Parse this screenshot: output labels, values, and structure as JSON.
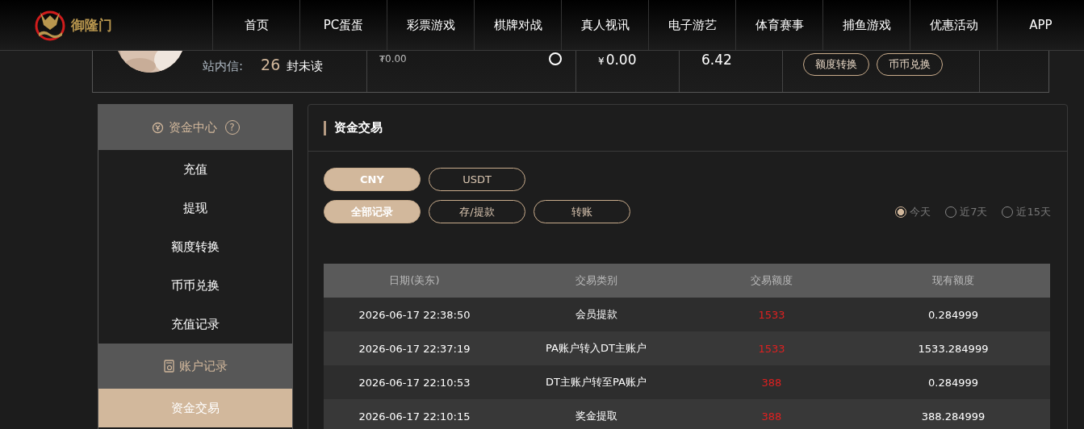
{
  "header": {
    "logo_text": "御隆门",
    "nav": [
      "首页",
      "PC蛋蛋",
      "彩票游戏",
      "棋牌对战",
      "真人视讯",
      "电子游艺",
      "体育赛事",
      "捕鱼游戏",
      "优惠活动",
      "APP"
    ]
  },
  "user_panel": {
    "messages_label": "站内信:",
    "unread_count": "26",
    "unread_suffix": "封未读",
    "balances": [
      {
        "kind": "small",
        "currency": "₮",
        "amount": "0.00"
      },
      {
        "kind": "large",
        "currency": "¥",
        "amount": "0.00"
      },
      {
        "kind": "large",
        "amount": "6.42"
      }
    ],
    "buttons": [
      "额度转换",
      "币币兑换"
    ]
  },
  "sidebar": [
    {
      "title": "资金中心",
      "help": "?",
      "items": [
        {
          "label": "充值",
          "selected": false
        },
        {
          "label": "提现",
          "selected": false
        },
        {
          "label": "额度转换",
          "selected": false
        },
        {
          "label": "币币兑换",
          "selected": false
        },
        {
          "label": "充值记录",
          "selected": false
        }
      ]
    },
    {
      "title": "账户记录",
      "items": [
        {
          "label": "资金交易",
          "selected": true
        }
      ]
    }
  ],
  "main": {
    "title": "资金交易",
    "currency_tabs": [
      {
        "label": "CNY",
        "selected": true
      },
      {
        "label": "USDT",
        "selected": false
      }
    ],
    "type_tabs": [
      {
        "label": "全部记录",
        "selected": true
      },
      {
        "label": "存/提款",
        "selected": false
      },
      {
        "label": "转账",
        "selected": false
      }
    ],
    "ranges": [
      {
        "label": "今天",
        "selected": true
      },
      {
        "label": "近7天",
        "selected": false
      },
      {
        "label": "近15天",
        "selected": false
      }
    ],
    "table": {
      "columns": [
        "日期(美东)",
        "交易类别",
        "交易额度",
        "现有额度"
      ],
      "rows": [
        [
          "2026-06-17 22:38:50",
          "会员提款",
          "1533",
          "0.284999"
        ],
        [
          "2026-06-17 22:37:19",
          "PA账户转入DT主账户",
          "1533",
          "1533.284999"
        ],
        [
          "2026-06-17 22:10:53",
          "DT主账户转至PA账户",
          "388",
          "0.284999"
        ],
        [
          "2026-06-17 22:10:15",
          "奖金提取",
          "388",
          "388.284999"
        ]
      ]
    }
  }
}
